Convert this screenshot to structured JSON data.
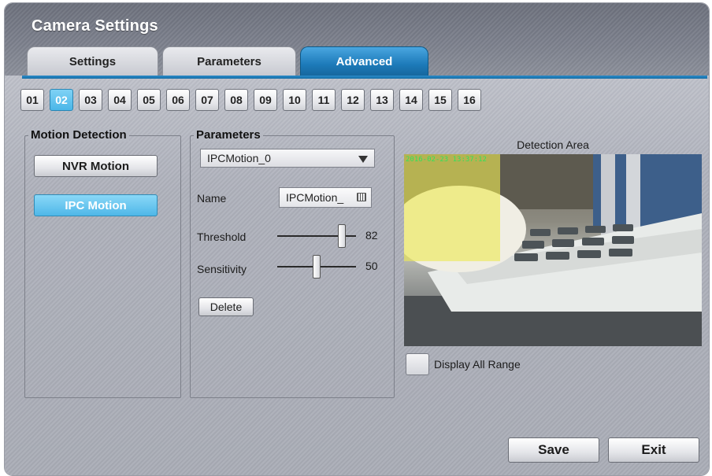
{
  "window": {
    "title": "Camera Settings"
  },
  "tabs": [
    {
      "label": "Settings"
    },
    {
      "label": "Parameters"
    },
    {
      "label": "Advanced"
    }
  ],
  "active_tab": "Advanced",
  "channels": [
    "01",
    "02",
    "03",
    "04",
    "05",
    "06",
    "07",
    "08",
    "09",
    "10",
    "11",
    "12",
    "13",
    "14",
    "15",
    "16"
  ],
  "selected_channel": "02",
  "motion_detection": {
    "title": "Motion Detection",
    "nvr_button": "NVR Motion",
    "ipc_button": "IPC Motion",
    "active": "IPC Motion"
  },
  "parameters": {
    "title": "Parameters",
    "selected_motion": "IPCMotion_0",
    "name_label": "Name",
    "name_value": "IPCMotion_",
    "threshold_label": "Threshold",
    "threshold_value": 82,
    "sensitivity_label": "Sensitivity",
    "sensitivity_value": 50,
    "delete_button": "Delete"
  },
  "detection": {
    "title": "Detection Area",
    "osd_timestamp": "2016-02-23  13:37:12",
    "display_all_range_label": "Display All Range",
    "display_all_range_checked": false
  },
  "footer": {
    "save": "Save",
    "exit": "Exit"
  },
  "colors": {
    "accent": "#1c7ab9",
    "selected": "#4ab6e8",
    "motion_area": "#eee854"
  },
  "icons": {
    "dropdown": "triangle-down",
    "keyboard": "keyboard-icon"
  }
}
